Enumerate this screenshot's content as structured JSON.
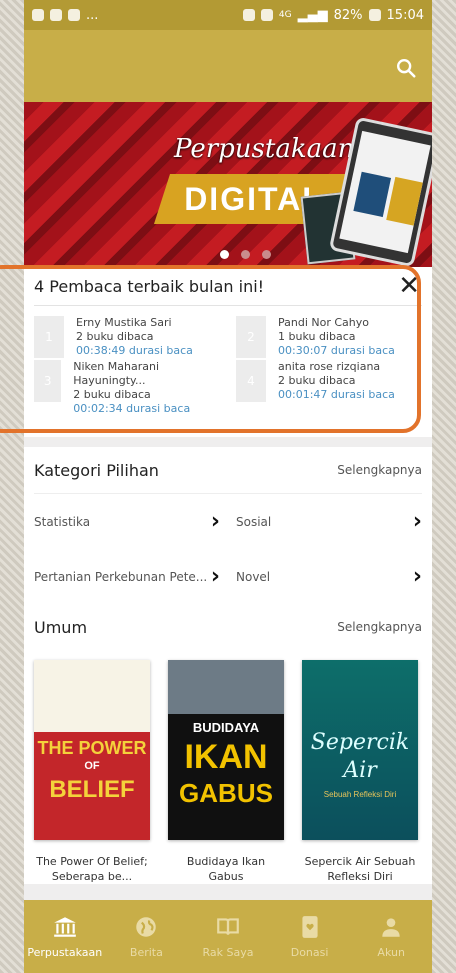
{
  "statusbar": {
    "left_text": "...",
    "right_text": "82%",
    "time": "15:04",
    "network": "4G"
  },
  "banner": {
    "title": "Perpustakaan",
    "subtitle": "DIGITAL"
  },
  "readers": {
    "title": "4 Pembaca terbaik bulan ini!",
    "close": "✕",
    "items": [
      {
        "rank": "1",
        "name": "Erny Mustika Sari",
        "books": "2 buku dibaca",
        "duration": "00:38:49 durasi baca"
      },
      {
        "rank": "2",
        "name": "Pandi Nor Cahyo",
        "books": "1 buku dibaca",
        "duration": "00:30:07 durasi baca"
      },
      {
        "rank": "3",
        "name": "Niken Maharani Hayuningty...",
        "books": "2 buku dibaca",
        "duration": "00:02:34 durasi baca"
      },
      {
        "rank": "4",
        "name": "anita rose rizqiana",
        "books": "2 buku dibaca",
        "duration": "00:01:47 durasi baca"
      }
    ]
  },
  "kategori": {
    "title": "Kategori Pilihan",
    "see_more": "Selengkapnya",
    "items": [
      "Statistika",
      "Sosial",
      "Pertanian Perkebunan Pete...",
      "Novel"
    ]
  },
  "umum": {
    "title": "Umum",
    "see_more": "Selengkapnya",
    "books": [
      {
        "title": "The Power Of Belief; Seberapa be...",
        "cover_top": "THE POWER",
        "cover_mid": "OF",
        "cover_bottom": "BELIEF"
      },
      {
        "title": "Budidaya Ikan Gabus",
        "cover_top": "BUDIDAYA",
        "cover_mid": "IKAN",
        "cover_bottom": "GABUS"
      },
      {
        "title": "Sepercik Air Sebuah Refleksi Diri",
        "cover_top": "Sepercik",
        "cover_mid": "Air",
        "cover_bottom": "Sebuah Refleksi Diri"
      }
    ]
  },
  "nav": {
    "items": [
      {
        "label": "Perpustakaan",
        "icon": "library-icon",
        "active": true
      },
      {
        "label": "Berita",
        "icon": "globe-icon",
        "active": false
      },
      {
        "label": "Rak Saya",
        "icon": "book-open-icon",
        "active": false
      },
      {
        "label": "Donasi",
        "icon": "donate-icon",
        "active": false
      },
      {
        "label": "Akun",
        "icon": "user-icon",
        "active": false
      }
    ]
  },
  "colors": {
    "appbar": "#c8ae48",
    "highlight": "#e2732b",
    "link": "#4a90c2"
  }
}
